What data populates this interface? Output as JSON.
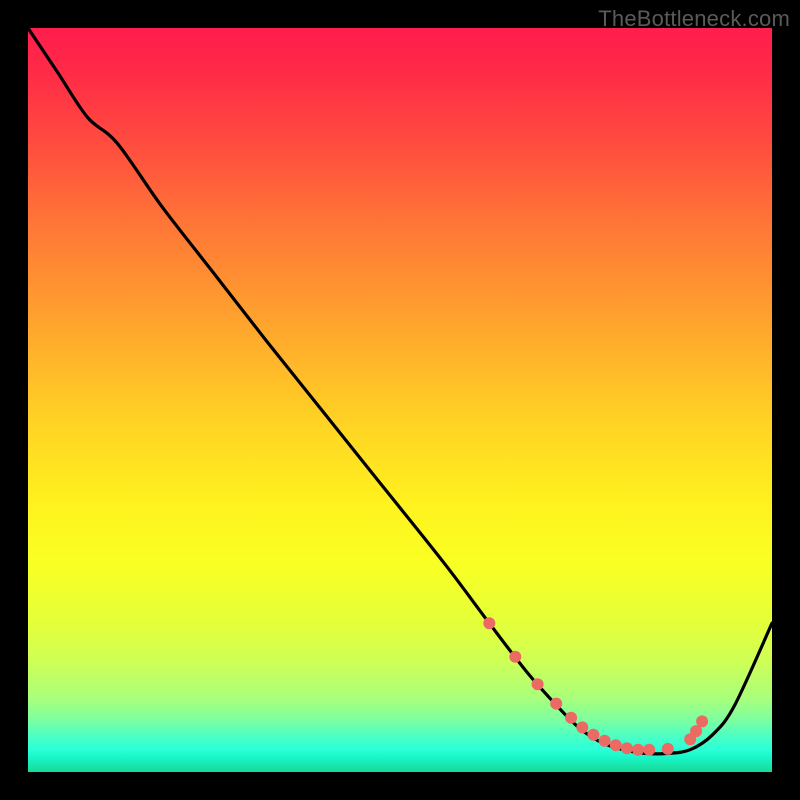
{
  "watermark": "TheBottleneck.com",
  "colors": {
    "background": "#000000",
    "curve": "#000000",
    "dots": "#eb6a63"
  },
  "chart_data": {
    "type": "line",
    "title": "",
    "xlabel": "",
    "ylabel": "",
    "xlim": [
      0,
      100
    ],
    "ylim": [
      0,
      100
    ],
    "grid": false,
    "legend": false,
    "series": [
      {
        "name": "bottleneck-curve",
        "x": [
          0,
          4,
          8,
          12,
          18,
          25,
          32,
          40,
          48,
          56,
          62,
          67,
          71,
          74,
          77,
          80,
          83,
          86,
          89,
          92,
          95,
          100
        ],
        "y": [
          100,
          94,
          88,
          84.5,
          76,
          67,
          58,
          48,
          38,
          28,
          20,
          13.5,
          9,
          6,
          4,
          3,
          2.5,
          2.5,
          3,
          5,
          9,
          20
        ]
      }
    ],
    "markers": {
      "name": "highlight-dots",
      "x": [
        62,
        65.5,
        68.5,
        71,
        73,
        74.5,
        76,
        77.5,
        79,
        80.5,
        82,
        83.5,
        86,
        89,
        89.8,
        90.6
      ],
      "y": [
        20,
        15.5,
        11.8,
        9.2,
        7.3,
        6.0,
        5.0,
        4.2,
        3.6,
        3.2,
        3.0,
        3.0,
        3.1,
        4.4,
        5.5,
        6.8
      ]
    }
  }
}
